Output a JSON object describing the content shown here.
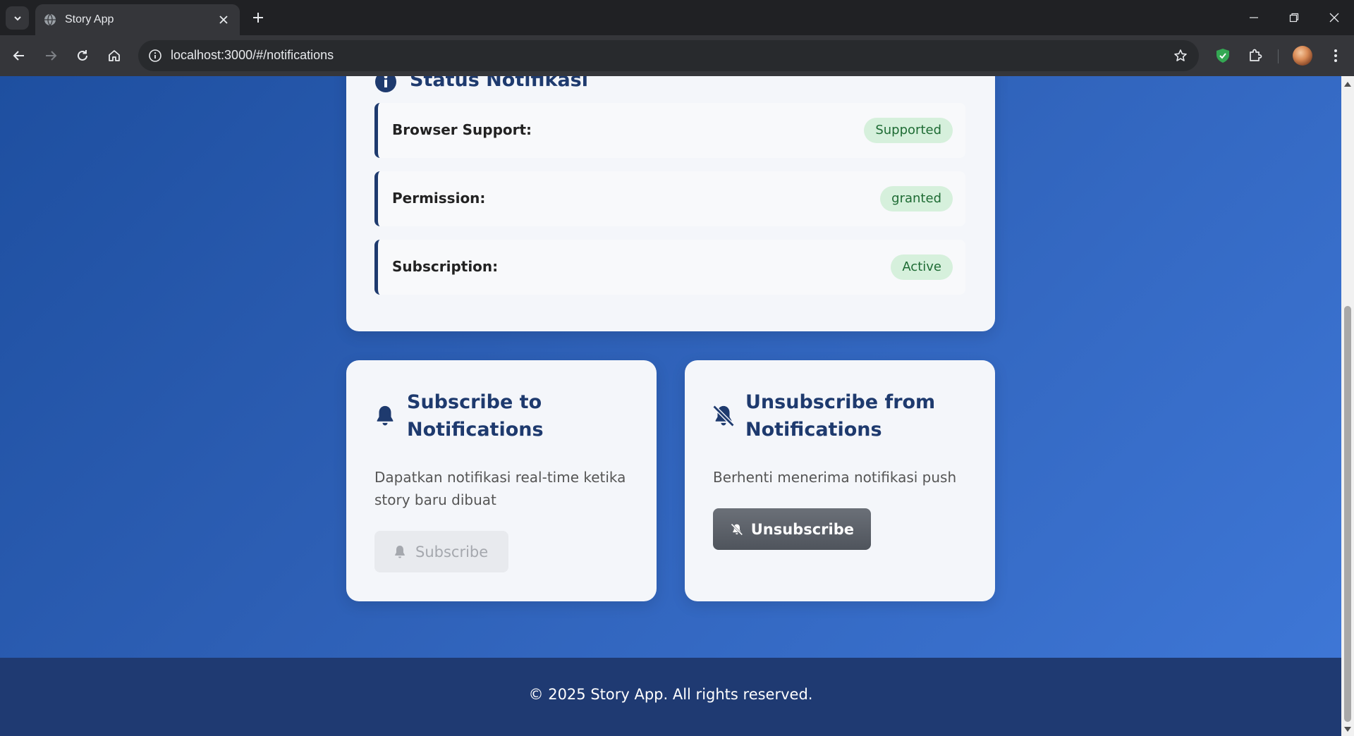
{
  "browser": {
    "tab_title": "Story App",
    "url": "localhost:3000/#/notifications"
  },
  "status": {
    "title": "Status Notifikasi",
    "rows": [
      {
        "label": "Browser Support:",
        "value": "Supported"
      },
      {
        "label": "Permission:",
        "value": "granted"
      },
      {
        "label": "Subscription:",
        "value": "Active"
      }
    ]
  },
  "subscribe": {
    "title": "Subscribe to Notifications",
    "description": "Dapatkan notifikasi real-time ketika story baru dibuat",
    "button_label": "Subscribe",
    "button_state": "disabled"
  },
  "unsubscribe": {
    "title": "Unsubscribe from Notifications",
    "description": "Berhenti menerima notifikasi push",
    "button_label": "Unsubscribe"
  },
  "footer": {
    "text": "© 2025 Story App. All rights reserved."
  },
  "colors": {
    "accent": "#1e3a6e",
    "badge_bg": "#d6f0dc",
    "badge_text": "#1e6b34",
    "footer_bg": "#1f3a72"
  },
  "icons": {
    "tab_favicon": "globe-icon",
    "info": "info-circle-icon",
    "subscribe": "bell-icon",
    "unsubscribe": "bell-slash-icon"
  }
}
